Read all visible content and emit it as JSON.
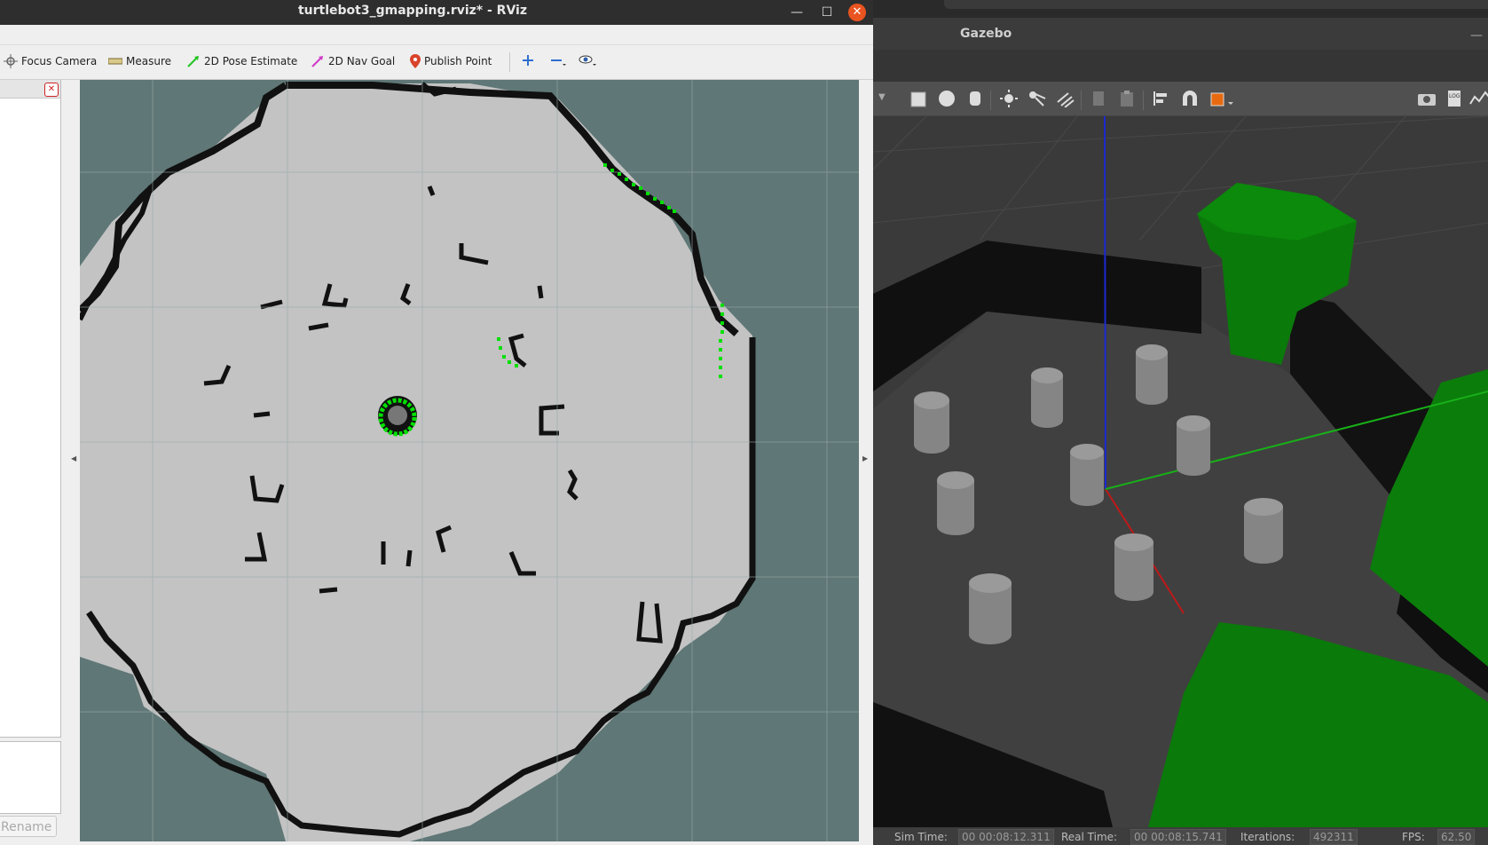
{
  "rviz": {
    "window_title": "turtlebot3_gmapping.rviz* - RViz",
    "window_buttons": {
      "minimize": "—",
      "maximize": "☐",
      "close": "✕"
    },
    "toolbar": [
      {
        "id": "focus-camera",
        "label": "Focus Camera",
        "icon": "focus-camera-icon"
      },
      {
        "id": "measure",
        "label": "Measure",
        "icon": "ruler-icon"
      },
      {
        "id": "pose-estimate",
        "label": "2D Pose Estimate",
        "icon": "green-arrow-icon"
      },
      {
        "id": "nav-goal",
        "label": "2D Nav Goal",
        "icon": "pink-arrow-icon"
      },
      {
        "id": "publish-point",
        "label": "Publish Point",
        "icon": "map-pin-icon"
      }
    ],
    "toolbar_extra_icons": [
      "add-tool-icon",
      "remove-tool-icon",
      "eye-icon"
    ],
    "panel": {
      "close_icon": "close-icon",
      "rename_label": "Rename"
    },
    "colors": {
      "unknown": "#5f7776",
      "free": "#c3c3c3",
      "occupied": "#111111",
      "laser": "#00e000"
    }
  },
  "gazebo": {
    "window_title": "Gazebo",
    "toolbar_icons": [
      "box-icon",
      "sphere-icon",
      "cylinder-icon",
      "point-light-icon",
      "spot-light-icon",
      "directional-light-icon",
      "copy-icon",
      "paste-icon",
      "align-icon",
      "snap-icon",
      "change-view-icon",
      "screenshot-icon",
      "log-icon",
      "plot-icon"
    ],
    "status": {
      "sim_time_label": "Sim Time:",
      "sim_time_value": "00 00:08:12.311",
      "real_time_label": "Real Time:",
      "real_time_value": "00 00:08:15.741",
      "iterations_label": "Iterations:",
      "iterations_value": "492311",
      "fps_label": "FPS:",
      "fps_value": "62.50"
    },
    "colors": {
      "floor": "#3c3c3c",
      "wall": "#111111",
      "green_block": "#0f7a0f",
      "cylinder": "#8c8c8c"
    }
  }
}
